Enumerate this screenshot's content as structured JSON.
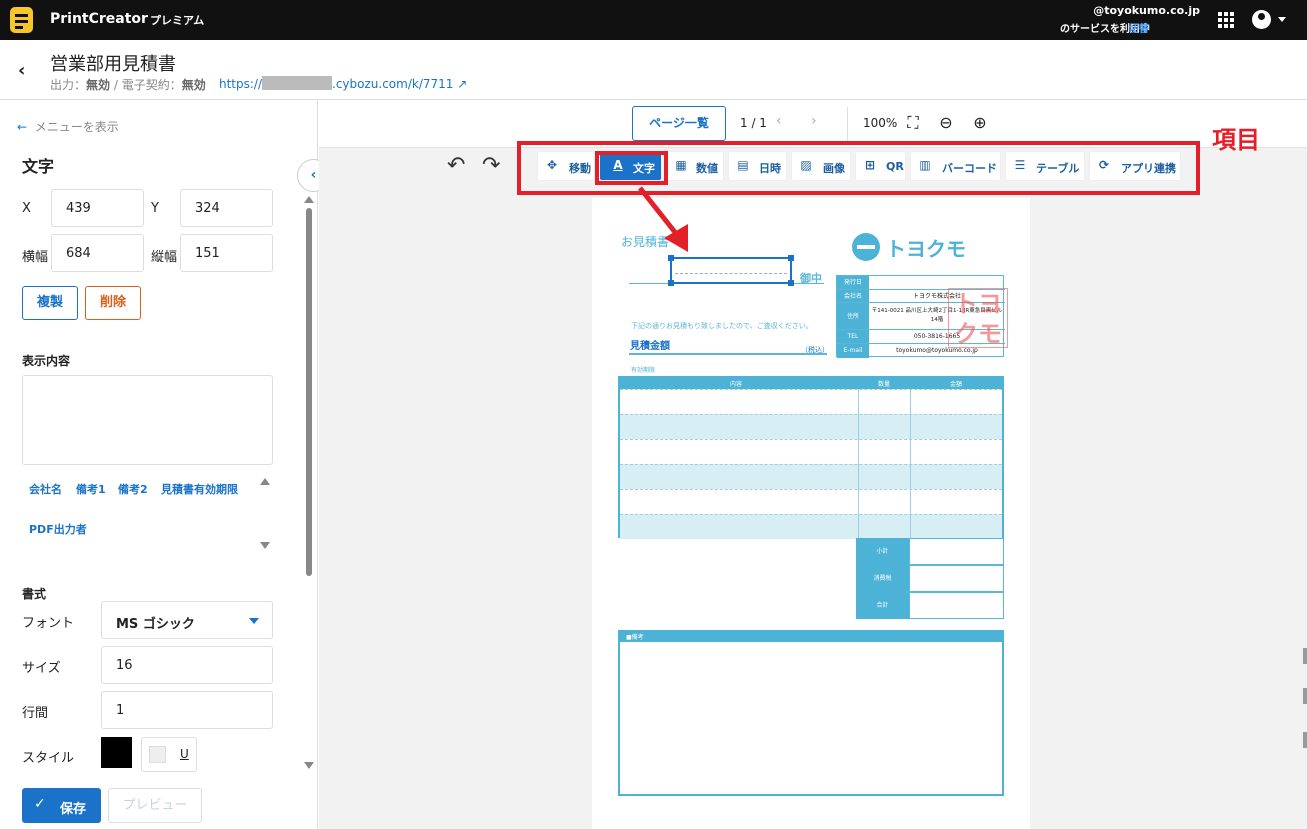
{
  "topbar": {
    "brand": "PrintCreator",
    "plan": "プレミアム",
    "user_domain": "@toyokumo.co.jp",
    "service_text": "のサービスを利用中",
    "switch_label": "切替"
  },
  "header": {
    "title": "営業部用見積書",
    "output_label": "出力：",
    "output_value": "無効",
    "econtract_label": " / 電子契約：",
    "econtract_value": "無効",
    "url_prefix": "https://",
    "url_suffix": ".cybozu.com/k/7711"
  },
  "sidebar": {
    "menu_toggle": "メニューを表示",
    "section_title": "文字",
    "x_label": "X",
    "x_value": "439",
    "y_label": "Y",
    "y_value": "324",
    "width_label": "横幅",
    "width_value": "684",
    "height_label": "縦幅",
    "height_value": "151",
    "duplicate_label": "複製",
    "delete_label": "削除",
    "content_title": "表示内容",
    "content_value": "",
    "chips": [
      "会社名",
      "備考1",
      "備考2",
      "見積書有効期限",
      "PDF出力者"
    ],
    "format_title": "書式",
    "font_label": "フォント",
    "font_value": "MS ゴシック",
    "size_label": "サイズ",
    "size_value": "16",
    "line_height_label": "行間",
    "line_height_value": "1",
    "style_label": "スタイル",
    "color_value": "#000000",
    "underline_label": "U",
    "save_label": "保存",
    "preview_label": "プレビュー"
  },
  "canvas": {
    "page_list_label": "ページ一覧",
    "page_indicator": "1 / 1",
    "zoom_level": "100%",
    "tools": [
      {
        "label": "移動",
        "icon": "move-icon",
        "active": false
      },
      {
        "label": "文字",
        "icon": "text-icon",
        "active": true
      },
      {
        "label": "数値",
        "icon": "calculator-icon",
        "active": false
      },
      {
        "label": "日時",
        "icon": "calendar-icon",
        "active": false
      },
      {
        "label": "画像",
        "icon": "image-icon",
        "active": false
      },
      {
        "label": "QR",
        "icon": "qr-icon",
        "active": false
      },
      {
        "label": "バーコード",
        "icon": "barcode-icon",
        "active": false
      },
      {
        "label": "テーブル",
        "icon": "table-icon",
        "active": false
      },
      {
        "label": "アプリ連携",
        "icon": "sync-icon",
        "active": false
      }
    ],
    "annotation_label": "項目"
  },
  "document": {
    "estimate_title": "お見積書",
    "honorific": "御中",
    "note": "下記の通りお見積もり致しましたので、ご査収ください。",
    "amount_label": "見積金額",
    "tax_included": "（税込）",
    "validity": "有効期限",
    "logo_text": "トヨクモ",
    "info": [
      {
        "key": "発行日",
        "value": ""
      },
      {
        "key": "会社名",
        "value": "トヨクモ株式会社"
      },
      {
        "key": "住所",
        "value": "〒141-0021 品川区上大崎2丁目1-1 JR東急目黒ビル14階"
      },
      {
        "key": "TEL",
        "value": "050-3816-1665"
      },
      {
        "key": "E-mail",
        "value": "toyokumo@toyokumo.co.jp"
      }
    ],
    "stamp_text": "トヨクモ",
    "columns": [
      "内容",
      "数量",
      "金額"
    ],
    "summary": [
      "小計",
      "消費税",
      "合計"
    ],
    "remark_title": "■備考"
  },
  "colors": {
    "accent": "#1a73c8",
    "danger": "#d9601a",
    "annotation": "#e3202a",
    "doc_teal": "#4cb3d6"
  }
}
